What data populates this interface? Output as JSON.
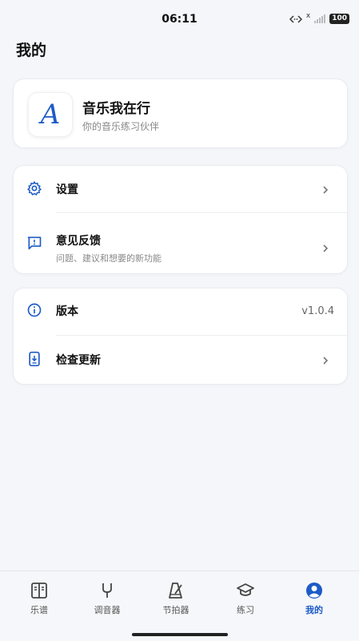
{
  "status_bar": {
    "time": "06:11",
    "x_mark": "x",
    "battery": "100"
  },
  "page": {
    "title": "我的"
  },
  "app": {
    "name": "音乐我在行",
    "tagline": "你的音乐练习伙伴",
    "logo_letter": "A"
  },
  "settings": {
    "items": [
      {
        "label": "设置",
        "icon": "gear-icon"
      },
      {
        "label": "意见反馈",
        "sub": "问题、建议和想要的新功能",
        "icon": "feedback-icon"
      }
    ]
  },
  "about": {
    "version_label": "版本",
    "version_value": "v1.0.4",
    "update_label": "检查更新"
  },
  "tabs": [
    {
      "label": "乐谱",
      "icon": "score-icon"
    },
    {
      "label": "调音器",
      "icon": "tuning-fork-icon"
    },
    {
      "label": "节拍器",
      "icon": "metronome-icon"
    },
    {
      "label": "练习",
      "icon": "graduation-cap-icon"
    },
    {
      "label": "我的",
      "icon": "profile-icon",
      "active": true
    }
  ],
  "colors": {
    "accent": "#1d5bc7",
    "background": "#f4f6fa",
    "card": "#ffffff"
  }
}
